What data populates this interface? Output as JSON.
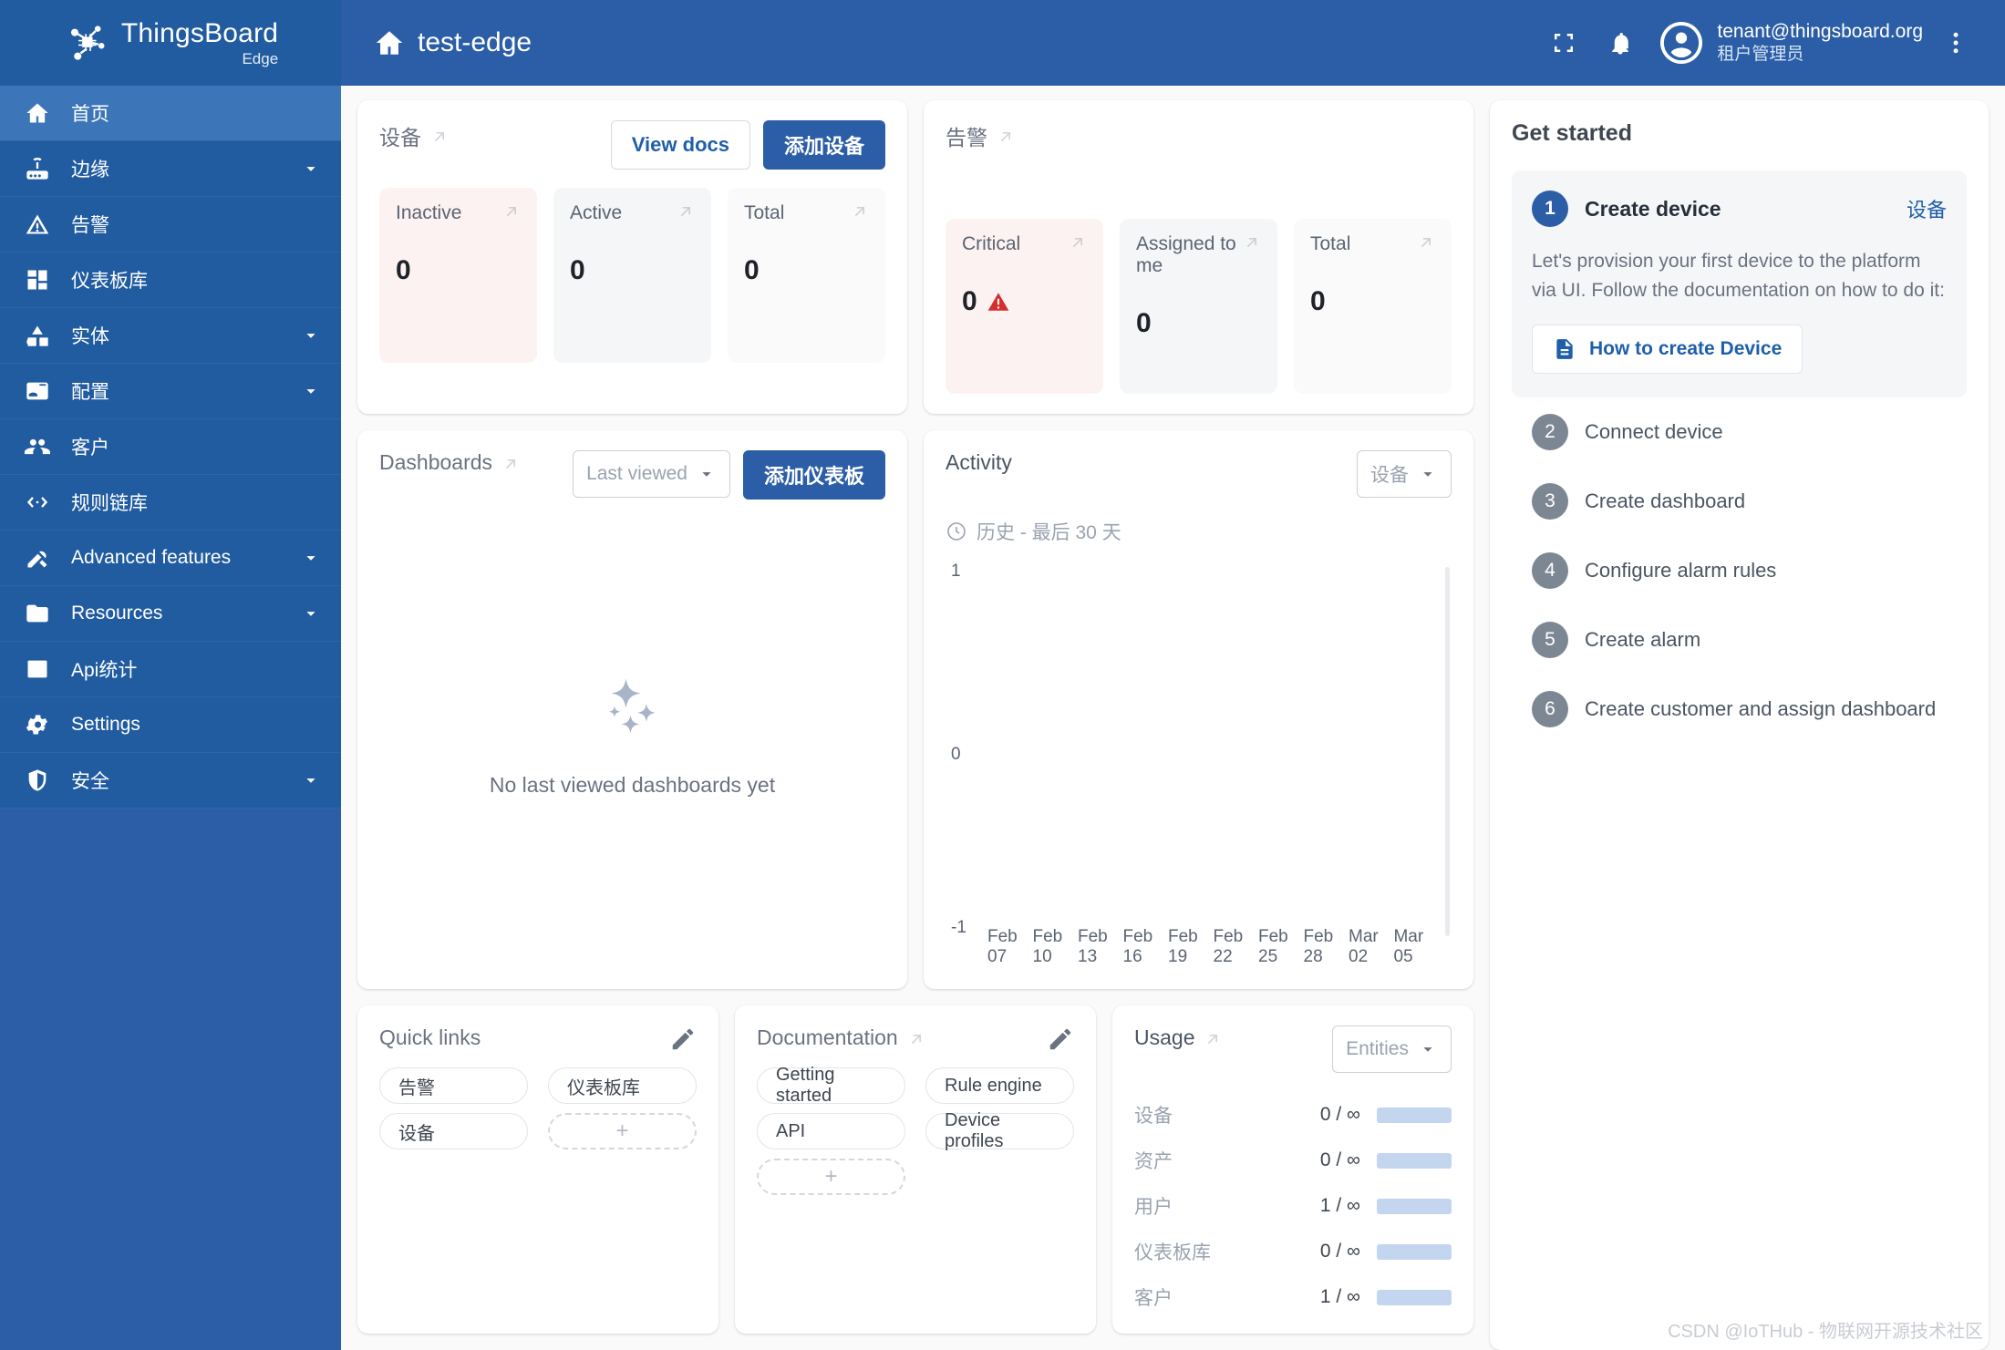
{
  "brand": {
    "name": "ThingsBoard",
    "sub": "Edge",
    "logo_icon": "thingsboard-logo-icon"
  },
  "sidebar": {
    "items": [
      {
        "label": "首页",
        "icon": "home-icon",
        "active": true,
        "expandable": false
      },
      {
        "label": "边缘",
        "icon": "router-icon",
        "active": false,
        "expandable": true
      },
      {
        "label": "告警",
        "icon": "alert-triangle-icon",
        "active": false,
        "expandable": false
      },
      {
        "label": "仪表板库",
        "icon": "dashboard-grid-icon",
        "active": false,
        "expandable": false
      },
      {
        "label": "实体",
        "icon": "entities-shapes-icon",
        "active": false,
        "expandable": true
      },
      {
        "label": "配置",
        "icon": "profile-card-icon",
        "active": false,
        "expandable": true
      },
      {
        "label": "客户",
        "icon": "people-icon",
        "active": false,
        "expandable": false
      },
      {
        "label": "规则链库",
        "icon": "rule-chain-icon",
        "active": false,
        "expandable": false
      },
      {
        "label": "Advanced features",
        "icon": "tools-icon",
        "active": false,
        "expandable": true
      },
      {
        "label": "Resources",
        "icon": "folder-icon",
        "active": false,
        "expandable": true
      },
      {
        "label": "Api统计",
        "icon": "bar-chart-icon",
        "active": false,
        "expandable": false
      },
      {
        "label": "Settings",
        "icon": "gear-icon",
        "active": false,
        "expandable": false
      },
      {
        "label": "安全",
        "icon": "shield-icon",
        "active": false,
        "expandable": true
      }
    ]
  },
  "topbar": {
    "home_icon": "home-icon",
    "title": "test-edge",
    "fullscreen_icon": "fullscreen-icon",
    "notifications_icon": "bell-icon",
    "avatar_icon": "account-circle-icon",
    "user_email": "tenant@thingsboard.org",
    "user_role": "租户管理员",
    "more_icon": "more-vertical-icon"
  },
  "devices_card": {
    "title": "设备",
    "view_docs_label": "View docs",
    "add_device_label": "添加设备",
    "tiles": [
      {
        "label": "Inactive",
        "value": "0",
        "tone": "red"
      },
      {
        "label": "Active",
        "value": "0",
        "tone": "grey"
      },
      {
        "label": "Total",
        "value": "0",
        "tone": "plain"
      }
    ]
  },
  "alarms_card": {
    "title": "告警",
    "tiles": [
      {
        "label": "Critical",
        "value": "0",
        "tone": "red",
        "warn": true
      },
      {
        "label": "Assigned to me",
        "value": "0",
        "tone": "grey",
        "warn": false
      },
      {
        "label": "Total",
        "value": "0",
        "tone": "plain",
        "warn": false
      }
    ]
  },
  "dashboards_card": {
    "title": "Dashboards",
    "sort_label": "Last viewed",
    "add_label": "添加仪表板",
    "empty_text": "No last viewed dashboards yet",
    "empty_icon": "sparkles-icon"
  },
  "activity_card": {
    "title": "Activity",
    "entity_select": "设备",
    "time_icon": "clock-icon",
    "time_label": "历史 - 最后 30 天"
  },
  "chart_data": {
    "type": "line",
    "title": "Activity",
    "xlabel": "",
    "ylabel": "",
    "ylim": [
      -1,
      1
    ],
    "yticks": [
      "1",
      "0",
      "-1"
    ],
    "x": [
      "Feb 07",
      "Feb 10",
      "Feb 13",
      "Feb 16",
      "Feb 19",
      "Feb 22",
      "Feb 25",
      "Feb 28",
      "Mar 02",
      "Mar 05"
    ],
    "series": [
      {
        "name": "设备",
        "values": [
          null,
          null,
          null,
          null,
          null,
          null,
          null,
          null,
          null,
          null
        ]
      }
    ],
    "grid": false,
    "legend": "none"
  },
  "quick_links_card": {
    "title": "Quick links",
    "edit_icon": "pencil-icon",
    "links": [
      "告警",
      "仪表板库",
      "设备"
    ],
    "add_label": "+"
  },
  "documentation_card": {
    "title": "Documentation",
    "edit_icon": "pencil-icon",
    "links": [
      "Getting started",
      "Rule engine",
      "API",
      "Device profiles"
    ],
    "add_label": "+"
  },
  "usage_card": {
    "title": "Usage",
    "select_label": "Entities",
    "rows": [
      {
        "name": "设备",
        "value": "0 / ∞"
      },
      {
        "name": "资产",
        "value": "0 / ∞"
      },
      {
        "name": "用户",
        "value": "1 / ∞"
      },
      {
        "name": "仪表板库",
        "value": "0 / ∞"
      },
      {
        "name": "客户",
        "value": "1 / ∞"
      }
    ]
  },
  "get_started": {
    "title": "Get started",
    "active_step": {
      "number": "1",
      "label": "Create device",
      "link_label": "设备",
      "description": "Let's provision your first device to the platform via UI. Follow the documentation on how to do it:",
      "doc_button_label": "How to create Device",
      "doc_icon": "document-icon"
    },
    "steps": [
      {
        "number": "2",
        "label": "Connect device"
      },
      {
        "number": "3",
        "label": "Create dashboard"
      },
      {
        "number": "4",
        "label": "Configure alarm rules"
      },
      {
        "number": "5",
        "label": "Create alarm"
      },
      {
        "number": "6",
        "label": "Create customer and assign dashboard"
      }
    ]
  },
  "watermark": "CSDN @IoTHub - 物联网开源技术社区",
  "colors": {
    "brand": "#2b5ea7",
    "danger": "#d32f2f",
    "bar": "#c3d5ef"
  }
}
